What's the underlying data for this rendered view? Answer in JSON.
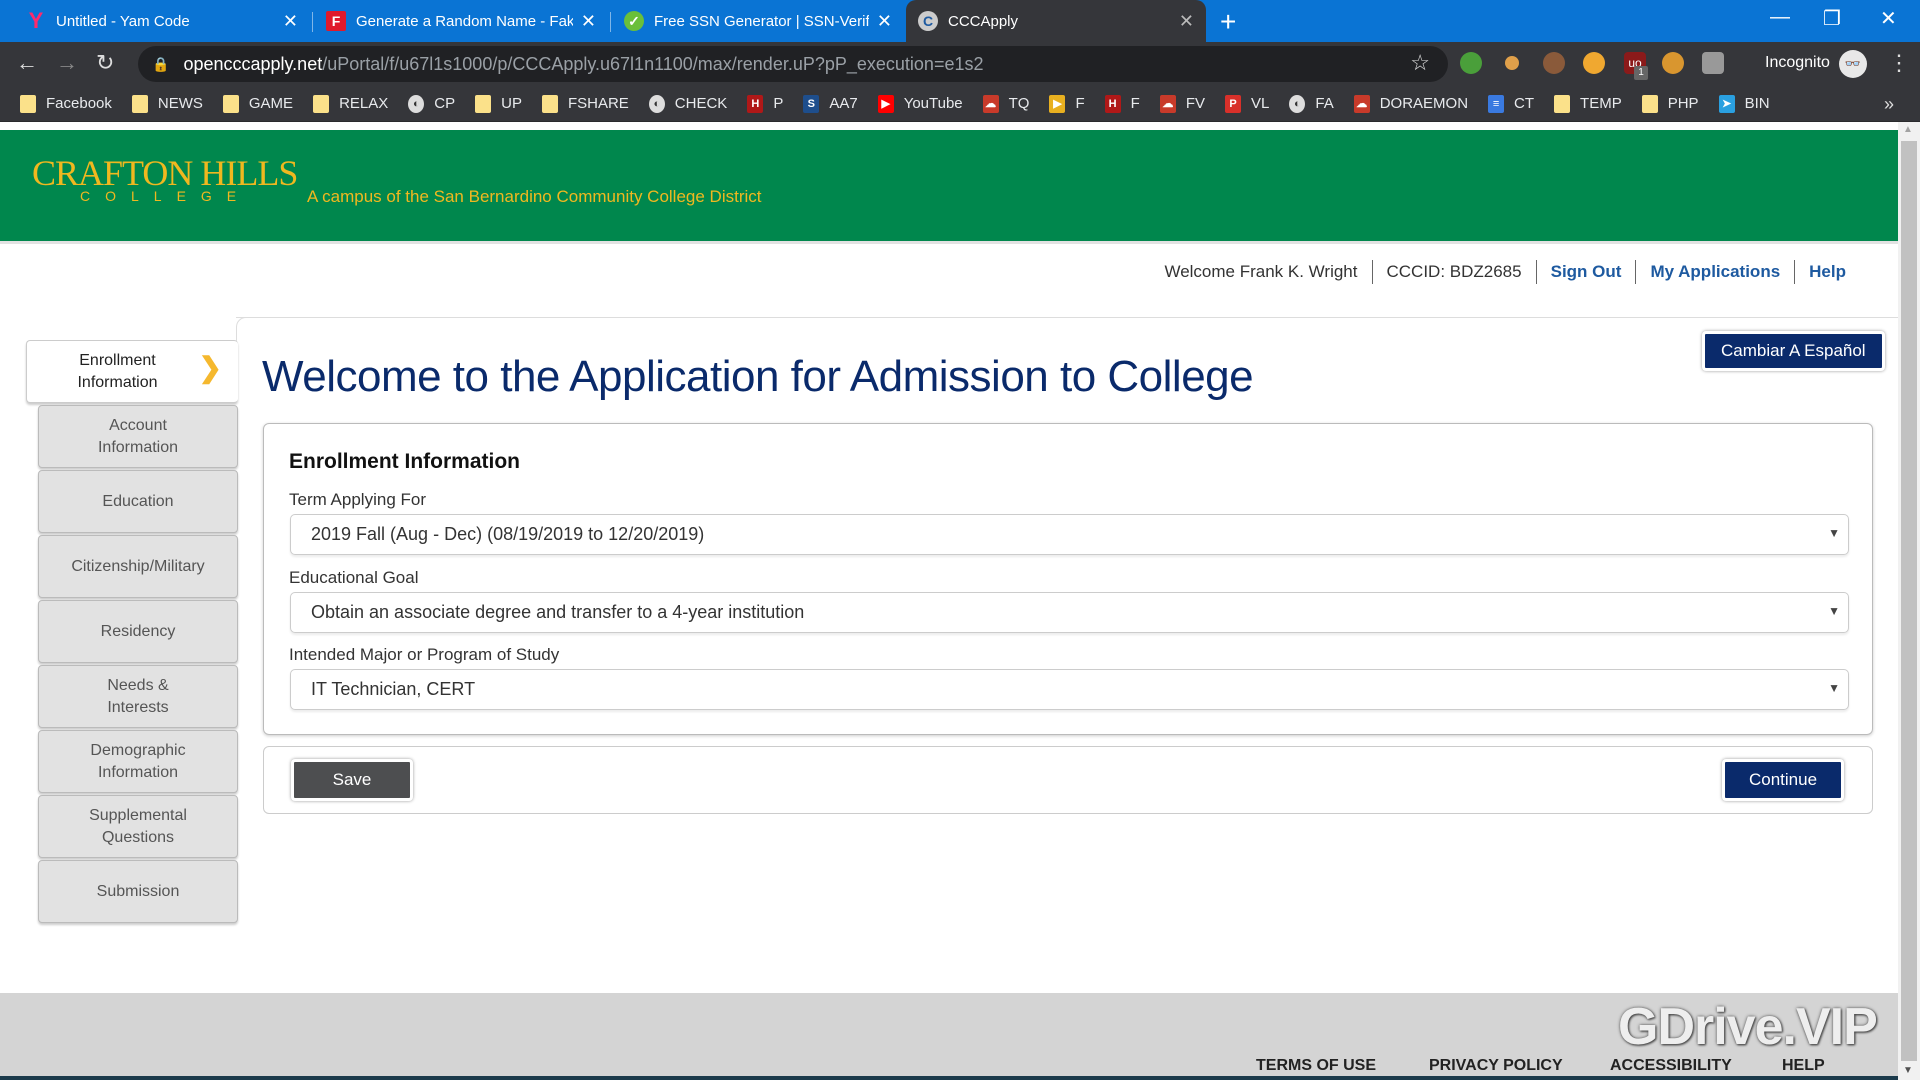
{
  "browser": {
    "tabs": [
      {
        "title": "Untitled - Yam Code",
        "icon": "yam-code-icon"
      },
      {
        "title": "Generate a Random Name - Fake",
        "icon": "fake-name-icon"
      },
      {
        "title": "Free SSN Generator | SSN-Verify.c",
        "icon": "check-circle-icon"
      },
      {
        "title": "CCCApply",
        "icon": "cccapply-icon",
        "active": true
      }
    ],
    "close_glyph": "✕",
    "new_tab_glyph": "+",
    "url_host": "opencccapply.net",
    "url_path": "/uPortal/f/u67l1s1000/p/CCCApply.u67l1n1100/max/render.uP?pP_execution=e1s2",
    "incognito_label": "Incognito",
    "extension_badge": "1",
    "bookmarks": [
      {
        "label": "Facebook",
        "icon": "folder"
      },
      {
        "label": "NEWS",
        "icon": "folder"
      },
      {
        "label": "GAME",
        "icon": "folder"
      },
      {
        "label": "RELAX",
        "icon": "folder"
      },
      {
        "label": "CP",
        "icon": "globe"
      },
      {
        "label": "UP",
        "icon": "folder"
      },
      {
        "label": "FSHARE",
        "icon": "folder"
      },
      {
        "label": "CHECK",
        "icon": "globe"
      },
      {
        "label": "P",
        "icon": "red-logo"
      },
      {
        "label": "AA7",
        "icon": "s-logo"
      },
      {
        "label": "YouTube",
        "icon": "youtube"
      },
      {
        "label": "TQ",
        "icon": "cloud"
      },
      {
        "label": "F",
        "icon": "play-circle"
      },
      {
        "label": "F",
        "icon": "red-logo"
      },
      {
        "label": "FV",
        "icon": "cloud"
      },
      {
        "label": "VL",
        "icon": "pdf"
      },
      {
        "label": "FA",
        "icon": "globe"
      },
      {
        "label": "DORAEMON",
        "icon": "cloud"
      },
      {
        "label": "CT",
        "icon": "doc"
      },
      {
        "label": "TEMP",
        "icon": "folder"
      },
      {
        "label": "PHP",
        "icon": "folder"
      },
      {
        "label": "BIN",
        "icon": "telegram"
      }
    ],
    "bookmarks_more": "»"
  },
  "site": {
    "logo_main": "CRAFTON HILLS",
    "logo_sub": "COLLEGE",
    "tagline": "A campus of the San Bernardino Community College District",
    "brand_green": "#00874d",
    "brand_gold": "#f0b81f",
    "brand_navy": "#0a2a6b"
  },
  "userbar": {
    "welcome": "Welcome Frank K. Wright",
    "cccid": "CCCID: BDZ2685",
    "sign_out": "Sign Out",
    "my_applications": "My Applications",
    "help": "Help"
  },
  "steps": [
    {
      "label": "Enrollment Information",
      "active": true
    },
    {
      "label": "Account Information"
    },
    {
      "label": "Education"
    },
    {
      "label": "Citizenship/Military"
    },
    {
      "label": "Residency"
    },
    {
      "label": "Needs & Interests"
    },
    {
      "label": "Demographic Information"
    },
    {
      "label": "Supplemental Questions"
    },
    {
      "label": "Submission"
    }
  ],
  "main": {
    "title": "Welcome to the Application for Admission to College",
    "language_button": "Cambiar A Español",
    "section_title": "Enrollment Information",
    "fields": [
      {
        "label": "Term Applying For",
        "value": "2019 Fall (Aug - Dec) (08/19/2019 to 12/20/2019)"
      },
      {
        "label": "Educational Goal",
        "value": "Obtain an associate degree and transfer to a 4-year institution"
      },
      {
        "label": "Intended Major or Program of Study",
        "value": "IT Technician, CERT"
      }
    ],
    "save_label": "Save",
    "continue_label": "Continue"
  },
  "footer": {
    "links": [
      "TERMS OF USE",
      "PRIVACY POLICY",
      "ACCESSIBILITY",
      "HELP"
    ],
    "watermark": "GDrive.VIP"
  }
}
